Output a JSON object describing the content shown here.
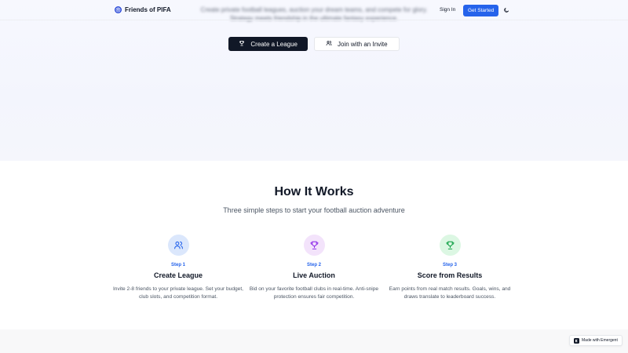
{
  "nav": {
    "brand": "Friends of PIFA",
    "sign_in": "Sign In",
    "get_started": "Get Started"
  },
  "hero": {
    "description": "Create private football leagues, auction your dream teams, and compete for glory. Strategy meets friendship in the ultimate fantasy experience.",
    "create_label": "Create a League",
    "join_label": "Join with an Invite"
  },
  "how_it_works": {
    "title": "How It Works",
    "subtitle": "Three simple steps to start your football auction adventure",
    "steps": [
      {
        "number": "Step 1",
        "title": "Create League",
        "description": "Invite 2-8 friends to your private league. Set your budget, club slots, and competition format.",
        "icon": "users-icon",
        "icon_bg": "#dbe7fc",
        "icon_color": "#2563eb"
      },
      {
        "number": "Step 2",
        "title": "Live Auction",
        "description": "Bid on your favorite football clubs in real-time. Anti-snipe protection ensures fair competition.",
        "icon": "trophy-icon",
        "icon_bg": "#f3e3fb",
        "icon_color": "#9333ea"
      },
      {
        "number": "Step 3",
        "title": "Score from Results",
        "description": "Earn points from real match results. Goals, wins, and draws translate to leaderboard success.",
        "icon": "trophy-icon",
        "icon_bg": "#dcf7e3",
        "icon_color": "#16a34a"
      }
    ]
  },
  "badge": {
    "label": "Made with Emergent"
  },
  "colors": {
    "primary_blue": "#2563eb",
    "dark_button": "#111827"
  }
}
